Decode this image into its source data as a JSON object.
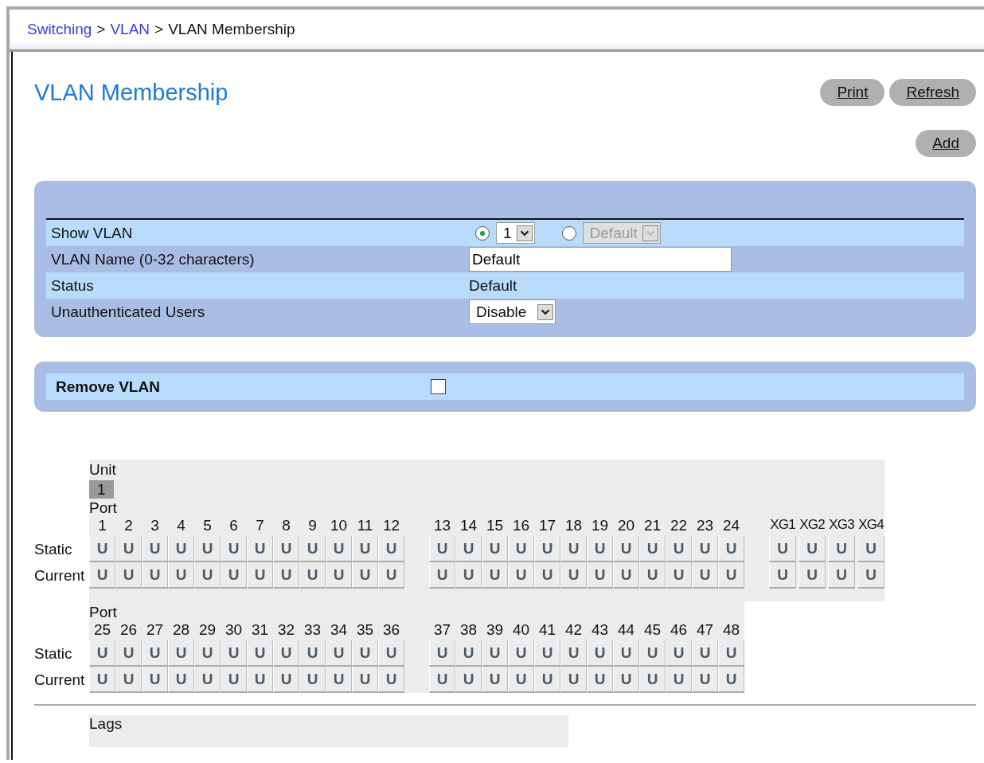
{
  "breadcrumb": [
    {
      "label": "Switching",
      "kind": "link"
    },
    {
      "label": "VLAN",
      "kind": "link"
    },
    {
      "label": "VLAN Membership",
      "kind": "current"
    }
  ],
  "breadcrumb_separator": ">",
  "title": "VLAN Membership",
  "buttons": [
    {
      "label": "Print"
    },
    {
      "label": "Refresh"
    }
  ],
  "add_button": {
    "label": "Add"
  },
  "form": {
    "rows": [
      {
        "label": "Show VLAN",
        "kind": "choice",
        "options": [
          {
            "value": "1",
            "selected": true,
            "disabled": false
          },
          {
            "value": "Default",
            "selected": false,
            "disabled": true
          }
        ]
      },
      {
        "label": "VLAN Name (0-32 characters)",
        "kind": "input",
        "value": "Default"
      },
      {
        "label": "Status",
        "kind": "text",
        "value": "Default"
      },
      {
        "label": "Unauthenticated Users",
        "kind": "select",
        "selected_value": "Disable"
      }
    ]
  },
  "remove": {
    "label": "Remove VLAN",
    "checked": false
  },
  "unit": {
    "label": "Unit",
    "units": [
      {
        "value": "1",
        "selected": true
      }
    ]
  },
  "port_blocks": [
    {
      "label": "Port",
      "row_labels": [
        "Static",
        "Current"
      ],
      "groups": [
        {
          "ports": [
            {
              "number": "1",
              "static": "U",
              "current": "U"
            },
            {
              "number": "2",
              "static": "U",
              "current": "U"
            },
            {
              "number": "3",
              "static": "U",
              "current": "U"
            },
            {
              "number": "4",
              "static": "U",
              "current": "U"
            },
            {
              "number": "5",
              "static": "U",
              "current": "U"
            },
            {
              "number": "6",
              "static": "U",
              "current": "U"
            },
            {
              "number": "7",
              "static": "U",
              "current": "U"
            },
            {
              "number": "8",
              "static": "U",
              "current": "U"
            },
            {
              "number": "9",
              "static": "U",
              "current": "U"
            },
            {
              "number": "10",
              "static": "U",
              "current": "U"
            },
            {
              "number": "11",
              "static": "U",
              "current": "U"
            },
            {
              "number": "12",
              "static": "U",
              "current": "U"
            }
          ]
        },
        {
          "ports": [
            {
              "number": "13",
              "static": "U",
              "current": "U"
            },
            {
              "number": "14",
              "static": "U",
              "current": "U"
            },
            {
              "number": "15",
              "static": "U",
              "current": "U"
            },
            {
              "number": "16",
              "static": "U",
              "current": "U"
            },
            {
              "number": "17",
              "static": "U",
              "current": "U"
            },
            {
              "number": "18",
              "static": "U",
              "current": "U"
            },
            {
              "number": "19",
              "static": "U",
              "current": "U"
            },
            {
              "number": "20",
              "static": "U",
              "current": "U"
            },
            {
              "number": "21",
              "static": "U",
              "current": "U"
            },
            {
              "number": "22",
              "static": "U",
              "current": "U"
            },
            {
              "number": "23",
              "static": "U",
              "current": "U"
            },
            {
              "number": "24",
              "static": "U",
              "current": "U"
            }
          ]
        },
        {
          "ports": [
            {
              "number": "XG1",
              "static": "U",
              "current": "U"
            },
            {
              "number": "XG2",
              "static": "U",
              "current": "U"
            },
            {
              "number": "XG3",
              "static": "U",
              "current": "U"
            },
            {
              "number": "XG4",
              "static": "U",
              "current": "U"
            }
          ]
        }
      ]
    },
    {
      "label": "Port",
      "row_labels": [
        "Static",
        "Current"
      ],
      "groups": [
        {
          "ports": [
            {
              "number": "25",
              "static": "U",
              "current": "U"
            },
            {
              "number": "26",
              "static": "U",
              "current": "U"
            },
            {
              "number": "27",
              "static": "U",
              "current": "U"
            },
            {
              "number": "28",
              "static": "U",
              "current": "U"
            },
            {
              "number": "29",
              "static": "U",
              "current": "U"
            },
            {
              "number": "30",
              "static": "U",
              "current": "U"
            },
            {
              "number": "31",
              "static": "U",
              "current": "U"
            },
            {
              "number": "32",
              "static": "U",
              "current": "U"
            },
            {
              "number": "33",
              "static": "U",
              "current": "U"
            },
            {
              "number": "34",
              "static": "U",
              "current": "U"
            },
            {
              "number": "35",
              "static": "U",
              "current": "U"
            },
            {
              "number": "36",
              "static": "U",
              "current": "U"
            }
          ]
        },
        {
          "ports": [
            {
              "number": "37",
              "static": "U",
              "current": "U"
            },
            {
              "number": "38",
              "static": "U",
              "current": "U"
            },
            {
              "number": "39",
              "static": "U",
              "current": "U"
            },
            {
              "number": "40",
              "static": "U",
              "current": "U"
            },
            {
              "number": "41",
              "static": "U",
              "current": "U"
            },
            {
              "number": "42",
              "static": "U",
              "current": "U"
            },
            {
              "number": "43",
              "static": "U",
              "current": "U"
            },
            {
              "number": "44",
              "static": "U",
              "current": "U"
            },
            {
              "number": "45",
              "static": "U",
              "current": "U"
            },
            {
              "number": "46",
              "static": "U",
              "current": "U"
            },
            {
              "number": "47",
              "static": "U",
              "current": "U"
            },
            {
              "number": "48",
              "static": "U",
              "current": "U"
            }
          ]
        }
      ]
    }
  ],
  "lags": {
    "label": "Lags"
  }
}
